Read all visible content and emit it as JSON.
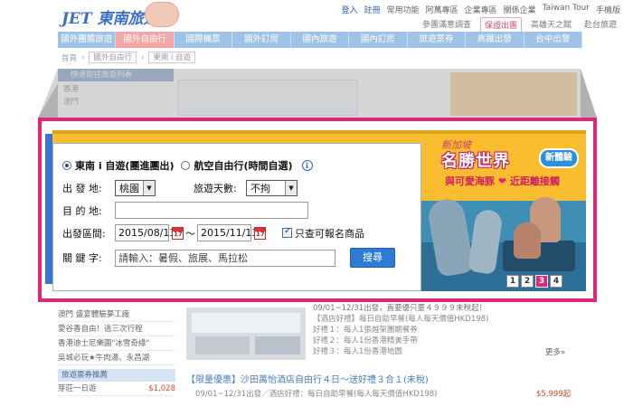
{
  "header": {
    "logo": "JET 東南旅遊",
    "top_links": [
      "登入",
      "註冊",
      "常用功能",
      "阿萬專區",
      "企業專區",
      "關係企業",
      "Taiwan Tour",
      "手機版"
    ],
    "sub_links": [
      "參團滿意調查",
      "保證出團",
      "高雄天之賦",
      "赴台旅遊"
    ]
  },
  "nav": {
    "items": [
      "國外團體旅遊",
      "國外自由行",
      "國際機票",
      "國外訂房",
      "國內旅遊",
      "國內訂房",
      "旅遊票券",
      "高鐵出發",
      "台中出發"
    ],
    "active_index": 1
  },
  "breadcrumb": [
    "首頁",
    "國外自由行",
    "東南 i 自遊"
  ],
  "sidebar": {
    "title": "快速前往旅遊列表",
    "items": [
      "香港",
      "澳門"
    ]
  },
  "search_form": {
    "radio_1": "東南 i 自遊(團進團出)",
    "radio_2": "航空自由行(時間自選)",
    "departure_label": "出 發 地:",
    "departure_value": "桃園",
    "days_label": "旅遊天數:",
    "days_value": "不拘",
    "destination_label": "目 的 地:",
    "destination_value": "",
    "date_label": "出發區間:",
    "date_from": "2015/08/13",
    "date_sep": "～",
    "date_to": "2015/11/13",
    "only_available_label": "只查可報名商品",
    "keyword_label": "關 鍵 字:",
    "keyword_placeholder": "請輸入：暑假、旅展、馬拉松",
    "search_button": "搜尋"
  },
  "ad": {
    "top_text": "新加坡",
    "title": "名勝世界",
    "badge": "新體驗",
    "subtitle_left": "與可愛海豚",
    "subtitle_right": "近距離接觸",
    "pages": [
      "1",
      "2",
      "3",
      "4"
    ],
    "current_page": "3"
  },
  "lower": {
    "left_items": [
      "澳門 盛宴體驗夢工廠",
      "愛谷香自由！逃三次行程",
      "香港迪士尼樂園\"冰雪奇緣\"",
      "吳城必玩★牛肉湯、永昌湖"
    ],
    "left_header": "旅遊票券推薦",
    "left_priced_item": "芽莊一日遊",
    "left_priced_value": "$1,028",
    "text_lines": [
      "09/01~12/31出發，直要優只要４９９９未稅起！",
      "【酒店好禮】每日自助早餐(每人每天價值HKD198)",
      "好禮１：每人1張越架團期餐券",
      "好禮２：每人1份香港精美手帶",
      "好禮３：每人1份香港地圖"
    ],
    "more": "更多»",
    "promo_title": "【限量優惠】沙田萬怡酒店自由行４日～送好禮３合１(未稅)",
    "promo_sub": "09/01~12/31出發／酒店好禮：每日自助早餐(每人每天價值HKD198)",
    "promo_price": "$5,999起"
  }
}
